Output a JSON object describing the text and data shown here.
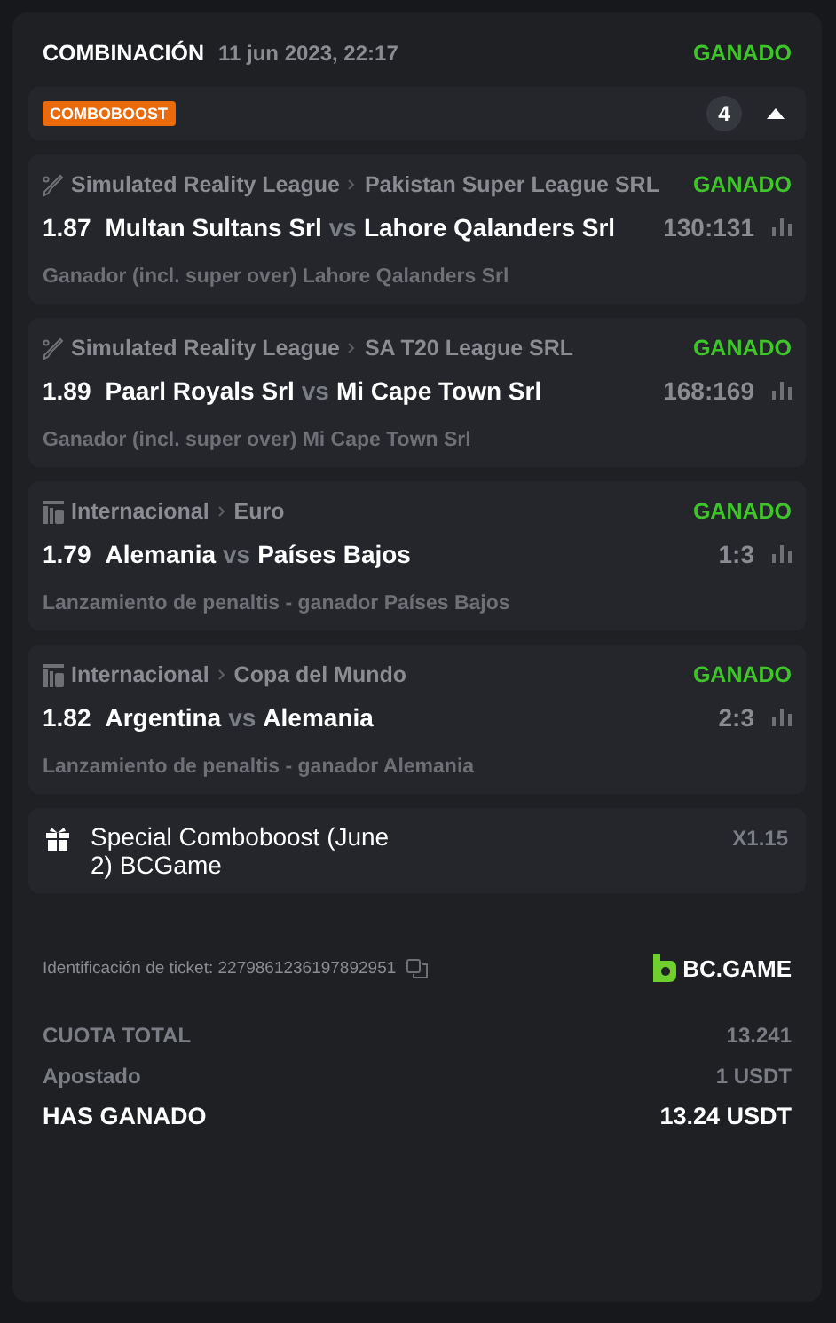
{
  "header": {
    "title": "COMBINACIÓN",
    "date": "11 jun 2023, 22:17",
    "status": "GANADO"
  },
  "boost": {
    "badge": "COMBOBOOST",
    "count": "4",
    "expanded": true
  },
  "legs": [
    {
      "kind": "cricket",
      "sport": "Simulated Reality League",
      "league": "Pakistan Super League SRL",
      "status": "GANADO",
      "odds": "1.87",
      "home": "Multan Sultans Srl",
      "vs": "vs",
      "away": "Lahore Qalanders Srl",
      "score": "130:131",
      "market": "Ganador (incl. super over) Lahore Qalanders Srl"
    },
    {
      "kind": "cricket",
      "sport": "Simulated Reality League",
      "league": "SA T20 League SRL",
      "status": "GANADO",
      "odds": "1.89",
      "home": "Paarl Royals Srl",
      "vs": "vs",
      "away": "Mi Cape Town Srl",
      "score": "168:169",
      "market": "Ganador (incl. super over) Mi Cape Town Srl"
    },
    {
      "kind": "penalty",
      "sport": "Internacional",
      "league": "Euro",
      "status": "GANADO",
      "odds": "1.79",
      "home": "Alemania",
      "vs": "vs",
      "away": "Países Bajos",
      "score": "1:3",
      "market": "Lanzamiento de penaltis - ganador Países Bajos"
    },
    {
      "kind": "penalty",
      "sport": "Internacional",
      "league": "Copa del Mundo",
      "status": "GANADO",
      "odds": "1.82",
      "home": "Argentina",
      "vs": "vs",
      "away": "Alemania",
      "score": "2:3",
      "market": "Lanzamiento de penaltis - ganador Alemania"
    }
  ],
  "special": {
    "title": "Special Comboboost (June 2) BCGame",
    "multiplier": "X1.15"
  },
  "ticket": {
    "label": "Identificación de ticket: 2279861236197892951",
    "brand": "BC.GAME"
  },
  "totals": [
    {
      "kind": "normal",
      "label": "CUOTA TOTAL",
      "value": "13.241"
    },
    {
      "kind": "normal",
      "label": "Apostado",
      "value": "1 USDT"
    },
    {
      "kind": "total",
      "label": "HAS GANADO",
      "value": "13.24 USDT"
    }
  ]
}
